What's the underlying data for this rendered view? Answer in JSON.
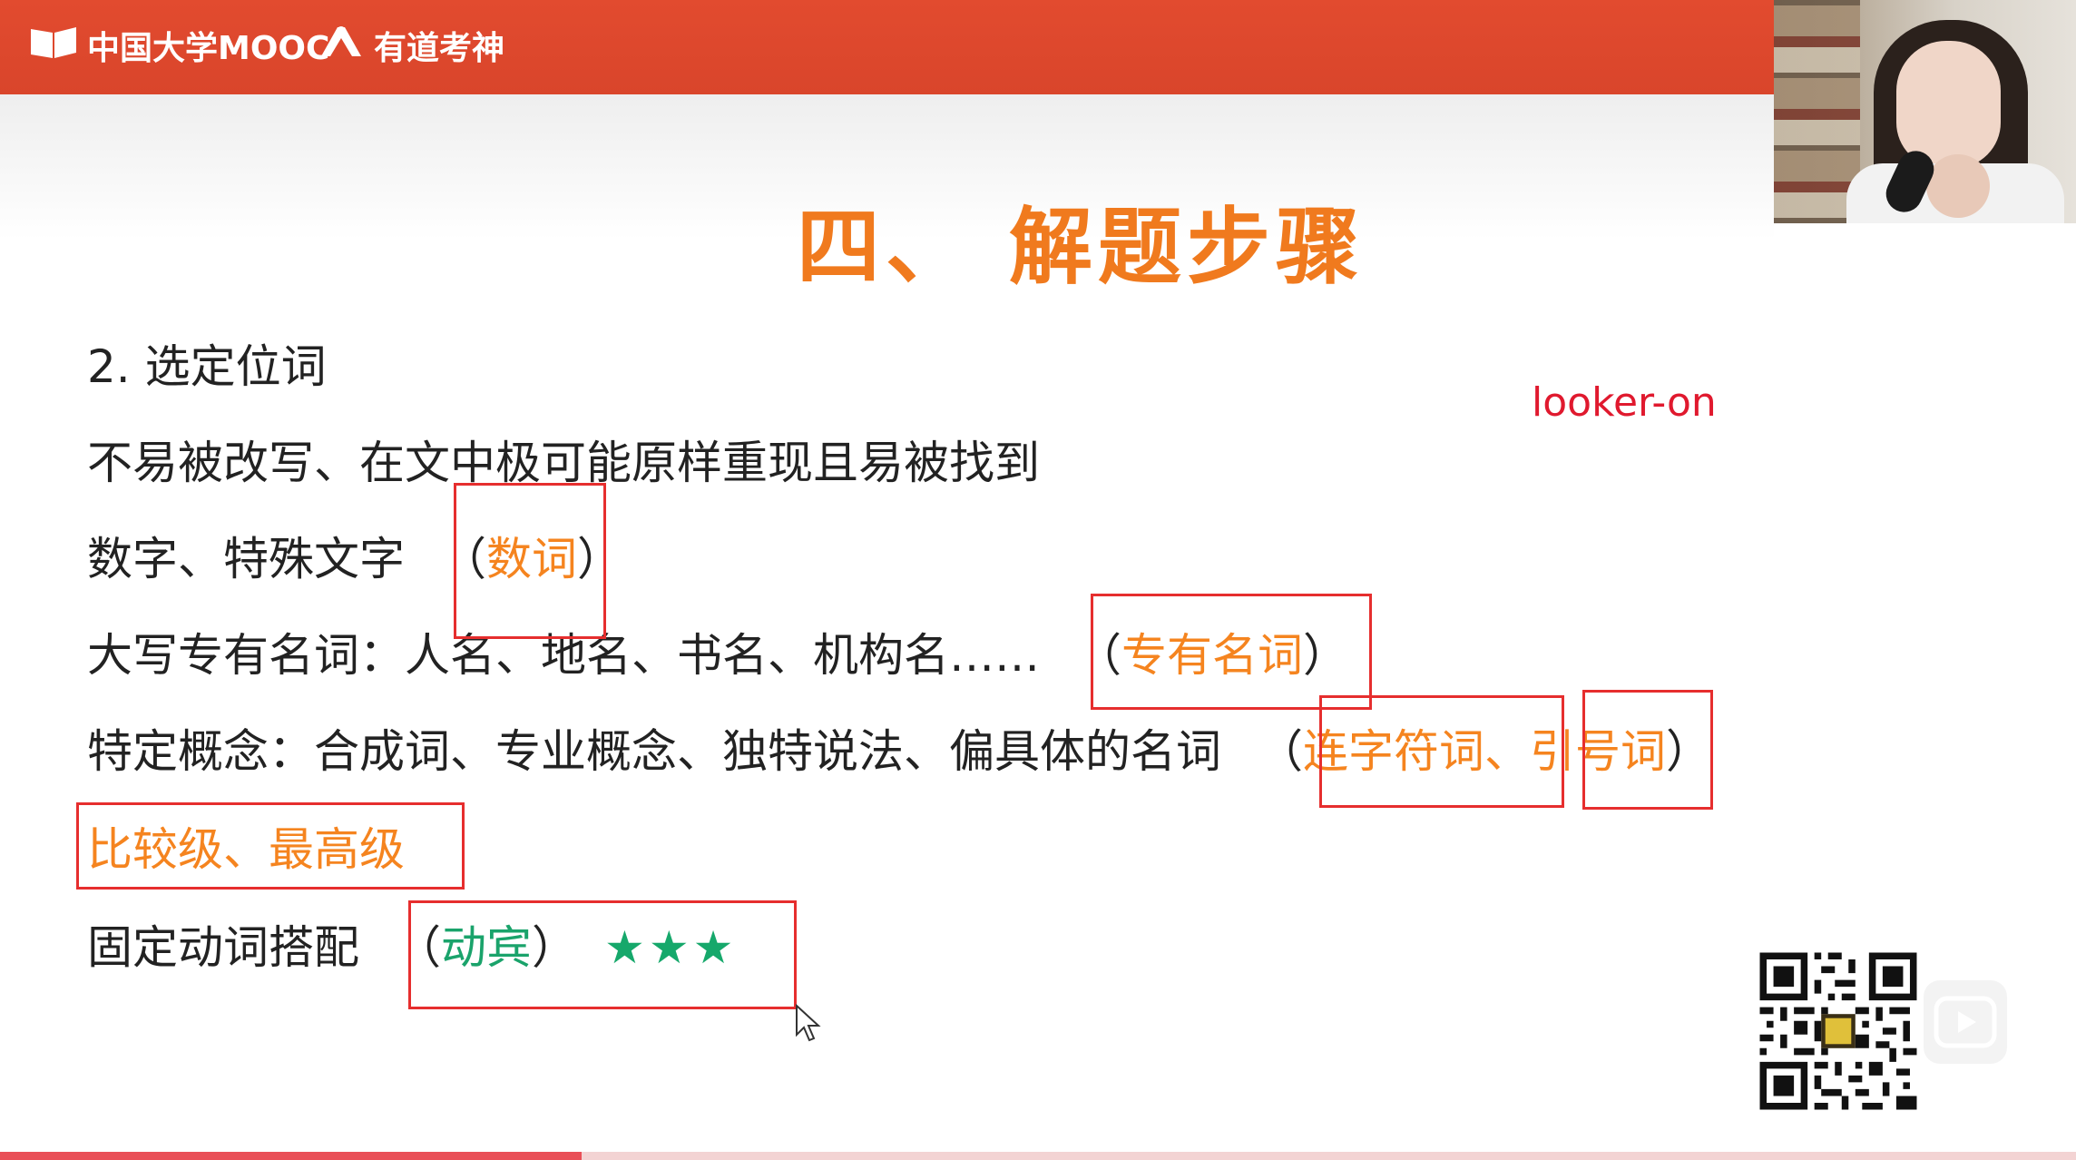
{
  "header": {
    "brand_mooc": "中国大学MOOC",
    "brand_youdao": "有道考神",
    "color": "#d9452b"
  },
  "slide": {
    "title": "四、 解题步骤",
    "subheading": "2. 选定位词",
    "annotation": "looker-on",
    "criteria": "不易被改写、在文中极可能原样重现且易被找到",
    "line_numbers": {
      "text": "数字、特殊文字",
      "paren_open": "（",
      "term": "数词",
      "paren_close": "）"
    },
    "line_proper": {
      "text": "大写专有名词：人名、地名、书名、机构名……",
      "paren_open": "（",
      "term": "专有名词",
      "paren_close": "）"
    },
    "line_concept": {
      "text": "特定概念：合成词、专业概念、独特说法、偏具体的名词",
      "paren_open": "（",
      "term": "连字符词、引号词",
      "paren_close": "）"
    },
    "line_compare": {
      "term": "比较级、最高级"
    },
    "line_verb": {
      "text": "固定动词搭配",
      "paren_open": "（",
      "term": "动宾",
      "paren_close": "）",
      "rating": "★★★"
    }
  },
  "colors": {
    "title": "#f07a1e",
    "term": "#f5841f",
    "green": "#1aa36b",
    "box": "#e62e2e",
    "annotation": "#e0192e"
  },
  "progress": {
    "fraction": 0.28
  },
  "icons": [
    "mooc-logo-icon",
    "youdao-logo-icon",
    "qr-code-icon",
    "play-icon",
    "cursor-icon"
  ]
}
